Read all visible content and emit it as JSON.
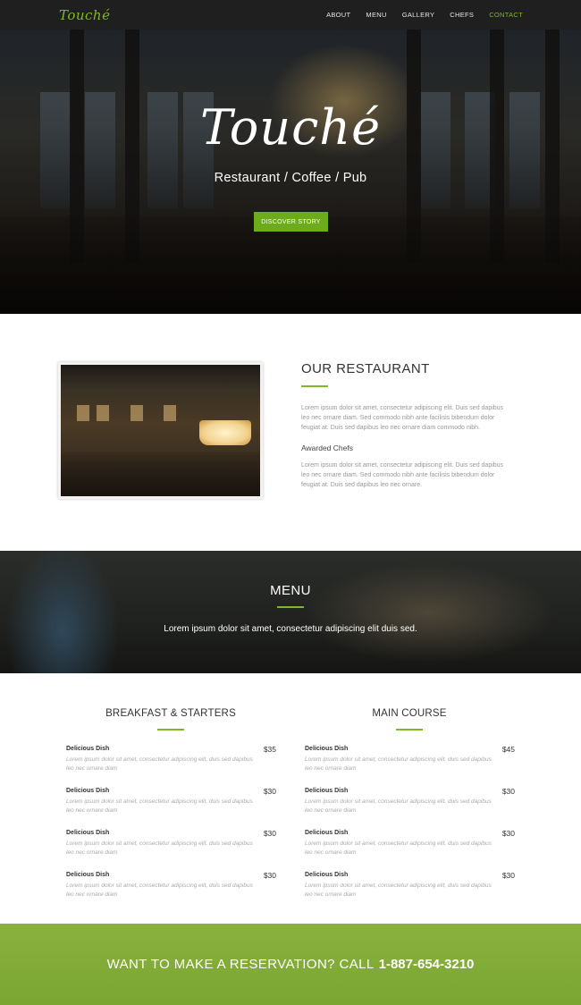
{
  "navbar": {
    "brand": "Touché",
    "links": [
      {
        "label": "ABOUT"
      },
      {
        "label": "MENU"
      },
      {
        "label": "GALLERY"
      },
      {
        "label": "CHEFS"
      },
      {
        "label": "CONTACT"
      }
    ],
    "active_link": "CONTACT"
  },
  "hero": {
    "title": "Touché",
    "subtitle": "Restaurant / Coffee / Pub",
    "button_label": "DISCOVER STORY"
  },
  "about": {
    "title": "OUR RESTAURANT",
    "paragraph1_lines": [
      "Lorem ipsum dolor sit amet, consectetur adipiscing elit. Duis sed dapibus",
      "leo nec ornare diam. Sed commodo nibh ante facilisis bibendum dolor",
      "feugiat at. Duis sed dapibus leo nec ornare diam commodo nibh."
    ],
    "subtitle": "Awarded Chefs",
    "paragraph2_lines": [
      "Lorem ipsum dolor sit amet, consectetur adipiscing elit. Duis sed dapibus",
      "leo nec ornare diam. Sed commodo nibh ante facilisis bibendum dolor",
      "feugiat at. Duis sed dapibus leo nec ornare."
    ]
  },
  "menu_banner": {
    "title": "MENU",
    "subtitle": "Lorem ipsum dolor sit amet, consectetur adipiscing elit duis sed."
  },
  "menu": {
    "left": {
      "title": "BREAKFAST & STARTERS",
      "items": [
        {
          "name": "Delicious Dish",
          "price": "$35",
          "desc1": "Lorem ipsum dolor sit amet, consectetur adipiscing elit, duis sed dapibus",
          "desc2": "leo nec ornare diam"
        },
        {
          "name": "Delicious Dish",
          "price": "$30",
          "desc1": "Lorem ipsum dolor sit amet, consectetur adipiscing elit, duis sed dapibus",
          "desc2": "leo nec ornare diam"
        },
        {
          "name": "Delicious Dish",
          "price": "$30",
          "desc1": "Lorem ipsum dolor sit amet, consectetur adipiscing elit, duis sed dapibus",
          "desc2": "leo nec ornare diam"
        },
        {
          "name": "Delicious Dish",
          "price": "$30",
          "desc1": "Lorem ipsum dolor sit amet, consectetur adipiscing elit, duis sed dapibus",
          "desc2": "leo nec ornare diam"
        }
      ]
    },
    "right": {
      "title": "MAIN COURSE",
      "items": [
        {
          "name": "Delicious Dish",
          "price": "$45",
          "desc1": "Lorem ipsum dolor sit amet, consectetur adipiscing elit, duis sed dapibus",
          "desc2": "leo nec ornare diam"
        },
        {
          "name": "Delicious Dish",
          "price": "$30",
          "desc1": "Lorem ipsum dolor sit amet, consectetur adipiscing elit, duis sed dapibus",
          "desc2": "leo nec ornare diam"
        },
        {
          "name": "Delicious Dish",
          "price": "$30",
          "desc1": "Lorem ipsum dolor sit amet, consectetur adipiscing elit, duis sed dapibus",
          "desc2": "leo nec ornare diam"
        },
        {
          "name": "Delicious Dish",
          "price": "$30",
          "desc1": "Lorem ipsum dolor sit amet, consectetur adipiscing elit, duis sed dapibus",
          "desc2": "leo nec ornare diam"
        }
      ]
    }
  },
  "reservation": {
    "text": "WANT TO MAKE A RESERVATION? CALL",
    "phone": "1-887-654-3210"
  },
  "colors": {
    "accent": "#7dbb24",
    "button": "#6bab1c",
    "nav_bg": "#1f1f1f",
    "reservation_bg": "#82ac38"
  }
}
